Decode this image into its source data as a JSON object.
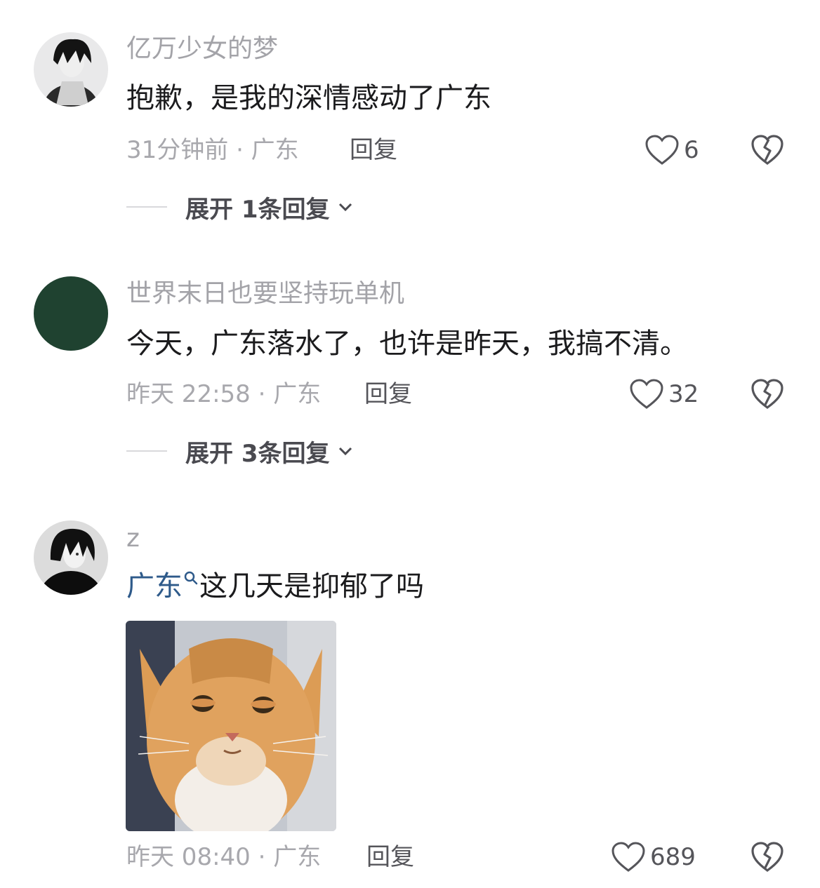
{
  "comments": [
    {
      "username": "亿万少女的梦",
      "text": "抱歉，是我的深情感动了广东",
      "time": "31分钟前 · 广东",
      "reply_label": "回复",
      "likes": "6",
      "expand_label": "展开 1条回复"
    },
    {
      "username": "世界末日也要坚持玩单机",
      "text": "今天，广东落水了，也许是昨天，我搞不清。",
      "time": "昨天 22:58 · 广东",
      "reply_label": "回复",
      "likes": "32",
      "expand_label": "展开 3条回复"
    },
    {
      "username": "z",
      "mention": "广东",
      "text": "这几天是抑郁了吗",
      "time": "昨天 08:40 · 广东",
      "reply_label": "回复",
      "likes": "689"
    }
  ],
  "colors": {
    "avatar2": "#1f4230",
    "mention": "#2e5a8a",
    "muted": "#a8a8ad"
  },
  "icons": {
    "like": "heart-outline-icon",
    "dislike": "broken-heart-icon",
    "expand": "chevron-down-icon",
    "search": "search-icon"
  }
}
